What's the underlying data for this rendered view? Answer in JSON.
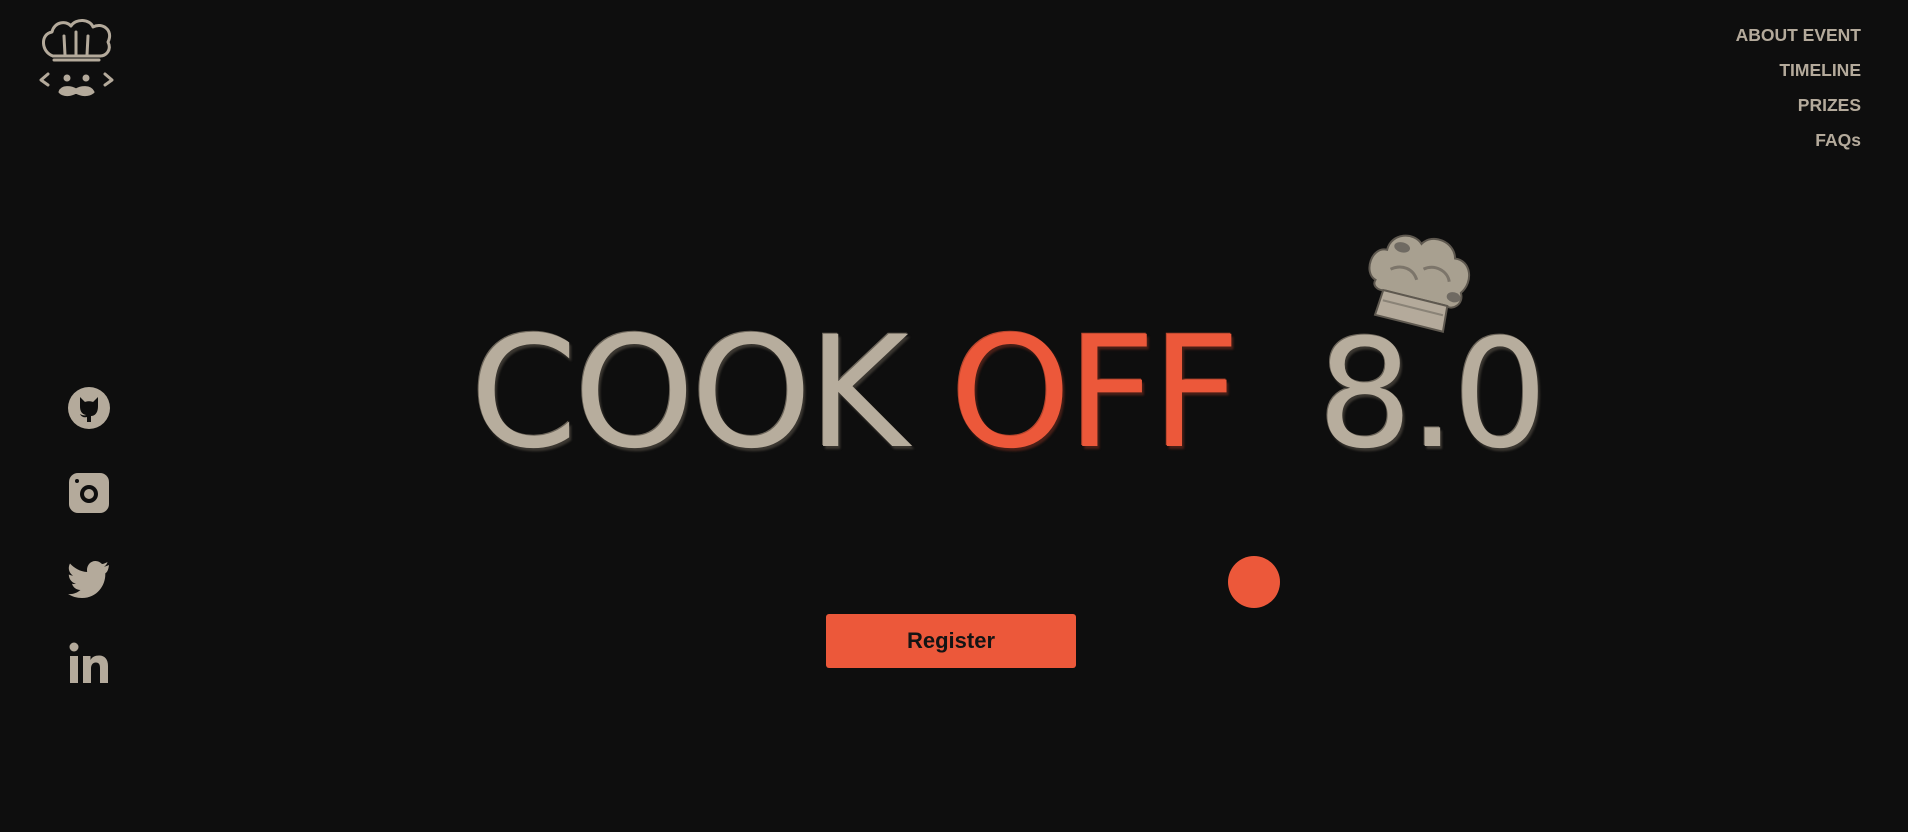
{
  "header": {
    "logo_icon": "chef-mustache-logo-icon",
    "nav": [
      {
        "label": "ABOUT EVENT"
      },
      {
        "label": "TIMELINE"
      },
      {
        "label": "PRIZES"
      },
      {
        "label": "FAQs"
      }
    ]
  },
  "social": [
    {
      "icon": "github-icon"
    },
    {
      "icon": "instagram-icon"
    },
    {
      "icon": "twitter-icon"
    },
    {
      "icon": "linkedin-icon"
    }
  ],
  "hero": {
    "title_part1": "COOK",
    "title_accent": "OFF",
    "title_part2": "8.0",
    "hat_icon": "chef-hat-icon"
  },
  "cta": {
    "register_label": "Register"
  },
  "colors": {
    "background": "#0e0e0e",
    "accent": "#ec583a",
    "beige": "#b4aa9b"
  }
}
